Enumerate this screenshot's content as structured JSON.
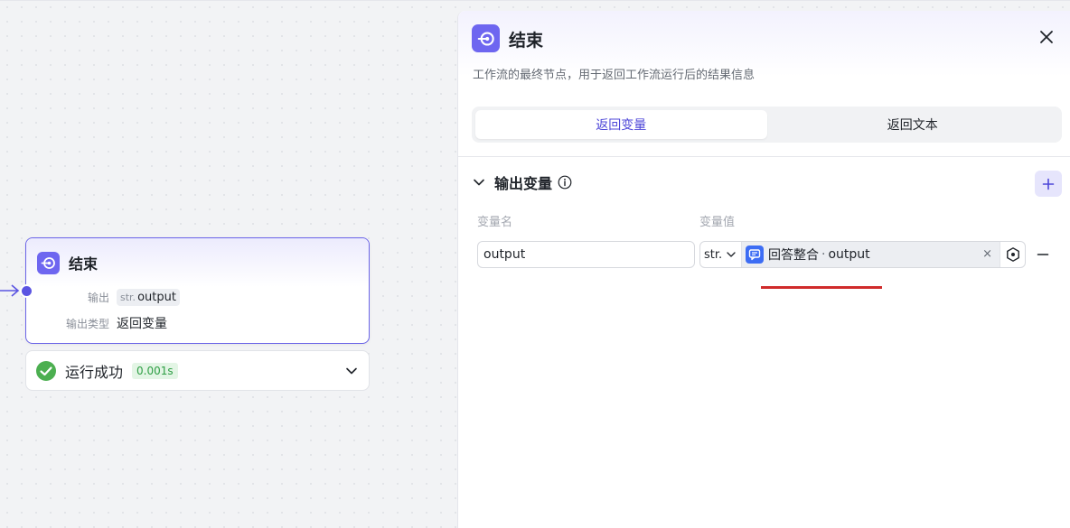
{
  "canvas": {
    "node": {
      "title": "结束",
      "output_label": "输出",
      "output_type_tag": "str.",
      "output_var": "output",
      "output_type_label": "输出类型",
      "output_type_value": "返回变量"
    },
    "status": {
      "text": "运行成功",
      "time": "0.001s"
    }
  },
  "panel": {
    "title": "结束",
    "description": "工作流的最终节点，用于返回工作流运行后的结果信息",
    "tabs": [
      {
        "label": "返回变量",
        "active": true
      },
      {
        "label": "返回文本",
        "active": false
      }
    ],
    "section": {
      "title": "输出变量",
      "col_name": "变量名",
      "col_value": "变量值",
      "rows": [
        {
          "name": "output",
          "type": "str.",
          "ref_node": "回答整合",
          "ref_sep": "·",
          "ref_var": "output",
          "clear": "×"
        }
      ]
    }
  },
  "icons": {
    "node_icon": "end-node-icon",
    "close": "close-icon",
    "collapse": "chevron-down-icon",
    "info": "info-icon",
    "add": "plus-icon",
    "remove": "minus-icon",
    "picker": "variable-picker-icon",
    "success": "check-circle-icon"
  },
  "colors": {
    "accent": "#6e66f0",
    "accent_text": "#4d46d8",
    "success": "#4caf50",
    "annotation": "#d02b2b"
  }
}
